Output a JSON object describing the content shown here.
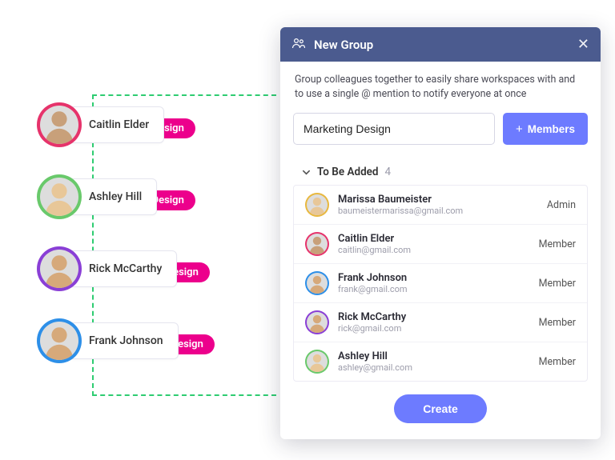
{
  "colors": {
    "avatar_rings": [
      "#e6336b",
      "#69c96b",
      "#8a3fd6",
      "#2d8fe8"
    ],
    "member_rings": [
      "#e8b83f",
      "#e6336b",
      "#2d8fe8",
      "#8a3fd6",
      "#69c96b"
    ],
    "tag_bg": "#ec008c"
  },
  "people": [
    {
      "name": "Caitlin Elder",
      "tag": "@Design"
    },
    {
      "name": "Ashley Hill",
      "tag": "@Design"
    },
    {
      "name": "Rick McCarthy",
      "tag": "@Design"
    },
    {
      "name": "Frank Johnson",
      "tag": "@Design"
    }
  ],
  "modal": {
    "title": "New Group",
    "help_text": "Group colleagues together to easily share workspaces with and to use a single @ mention to notify everyone at once",
    "name_value": "Marketing Design",
    "members_button": "Members",
    "section_label": "To Be Added",
    "section_count": "4",
    "create_label": "Create",
    "members": [
      {
        "name": "Marissa Baumeister",
        "email": "baumeistermarissa@gmail.com",
        "role": "Admin"
      },
      {
        "name": "Caitlin Elder",
        "email": "caitlin@gmail.com",
        "role": "Member"
      },
      {
        "name": "Frank Johnson",
        "email": "frank@gmail.com",
        "role": "Member"
      },
      {
        "name": "Rick McCarthy",
        "email": "rick@gmail.com",
        "role": "Member"
      },
      {
        "name": "Ashley Hill",
        "email": "ashley@gmail.com",
        "role": "Member"
      }
    ]
  }
}
